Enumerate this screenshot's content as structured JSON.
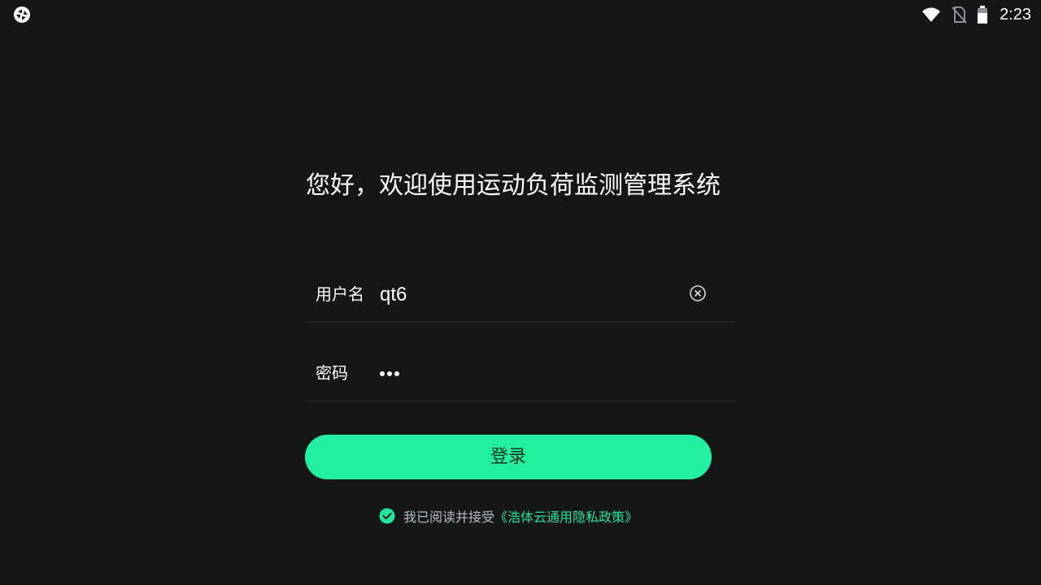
{
  "status_bar": {
    "time": "2:23",
    "icons": [
      "app-logo-icon",
      "wifi-icon",
      "no-sim-icon",
      "battery-icon"
    ]
  },
  "login": {
    "welcome": "您好，欢迎使用运动负荷监测管理系统",
    "username_label": "用户名",
    "username_value": "qt6",
    "password_label": "密码",
    "password_length": 3,
    "login_button": "登录",
    "agreement_prefix": "我已阅读并接受",
    "agreement_link": "《浩体云通用隐私政策》",
    "agreement_checked": true
  },
  "colors": {
    "background": "#151618",
    "accent": "#22f09e",
    "link": "#22e699",
    "divider": "#2e2f33"
  }
}
